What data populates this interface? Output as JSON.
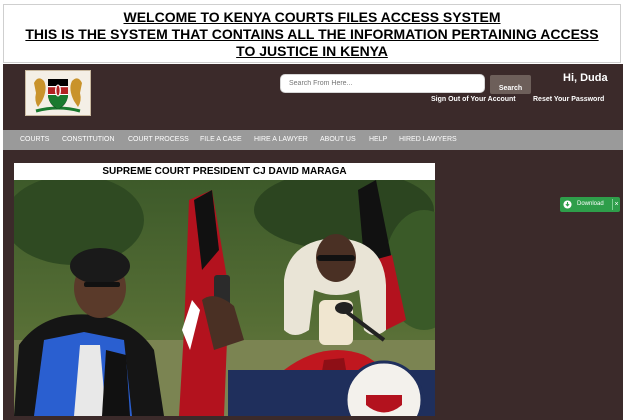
{
  "banner": {
    "line1": "WELCOME TO KENYA COURTS FILES ACCESS SYSTEM",
    "line2": "THIS IS THE SYSTEM THAT CONTAINS ALL THE INFORMATION PERTAINING ACCESS",
    "line3": "TO JUSTICE IN KENYA"
  },
  "header": {
    "logo_icon": "kenya-coat-of-arms-icon",
    "search_placeholder": "Search From Here...",
    "search_button": "Search",
    "greeting": "Hi, Duda",
    "sign_out": "Sign Out of Your Account",
    "reset_password": "Reset Your Password"
  },
  "nav": {
    "items": [
      "COURTS",
      "CONSTITUTION",
      "COURT PROCESS",
      "FILE A CASE",
      "HIRE A LAWYER",
      "ABOUT US",
      "HELP",
      "HIRED LAWYERS"
    ]
  },
  "feature": {
    "caption": "SUPREME COURT PRESIDENT CJ DAVID MARAGA"
  },
  "download": {
    "label": "Download",
    "close": "×",
    "icon": "download-icon"
  },
  "colors": {
    "main_bg": "#3b2a2a",
    "nav_bg": "#9a9a9a",
    "download_bg": "#2e9e4a"
  }
}
